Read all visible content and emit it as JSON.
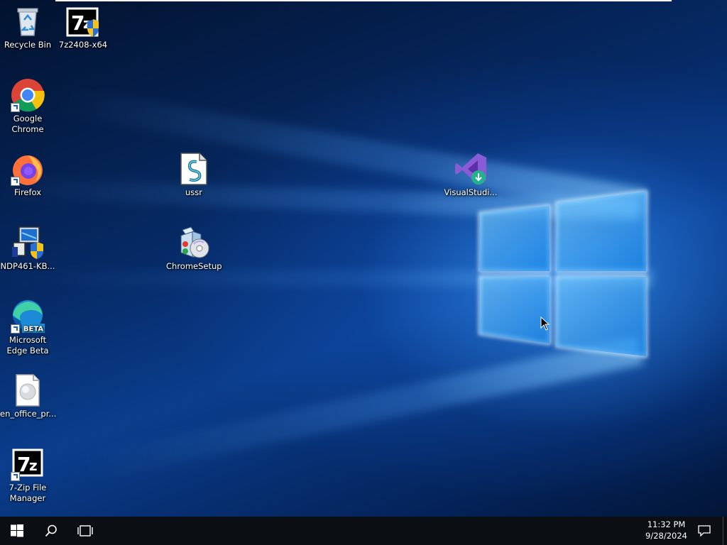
{
  "desktop": {
    "icons": [
      {
        "label": "Recycle Bin",
        "icon": "recycle-bin-icon"
      },
      {
        "label": "7z2408-x64",
        "icon": "installer-7zip-icon"
      },
      {
        "label": "Google Chrome",
        "icon": "chrome-icon"
      },
      {
        "label": "Firefox",
        "icon": "firefox-icon"
      },
      {
        "label": "ussr",
        "icon": "script-file-icon"
      },
      {
        "label": "VisualStudi...",
        "icon": "visual-studio-installer-icon"
      },
      {
        "label": "NDP461-KB...",
        "icon": "dotnet-installer-icon"
      },
      {
        "label": "ChromeSetup",
        "icon": "setup-package-icon"
      },
      {
        "label": "Microsoft Edge Beta",
        "icon": "edge-beta-icon",
        "badge": "BETA"
      },
      {
        "label": "en_office_pr...",
        "icon": "disc-image-file-icon"
      },
      {
        "label": "7-Zip File Manager",
        "icon": "7zip-icon"
      }
    ]
  },
  "taskbar": {
    "start_icon": "windows-start-icon",
    "search_icon": "search-icon",
    "task_view_icon": "task-view-icon",
    "time": "11:32 PM",
    "date": "9/28/2024",
    "notifications_icon": "action-center-icon"
  },
  "colors": {
    "taskbar_bg": "#0b0f14",
    "desktop_accent": "#0a3d8c",
    "glow": "#3ca0ff"
  }
}
